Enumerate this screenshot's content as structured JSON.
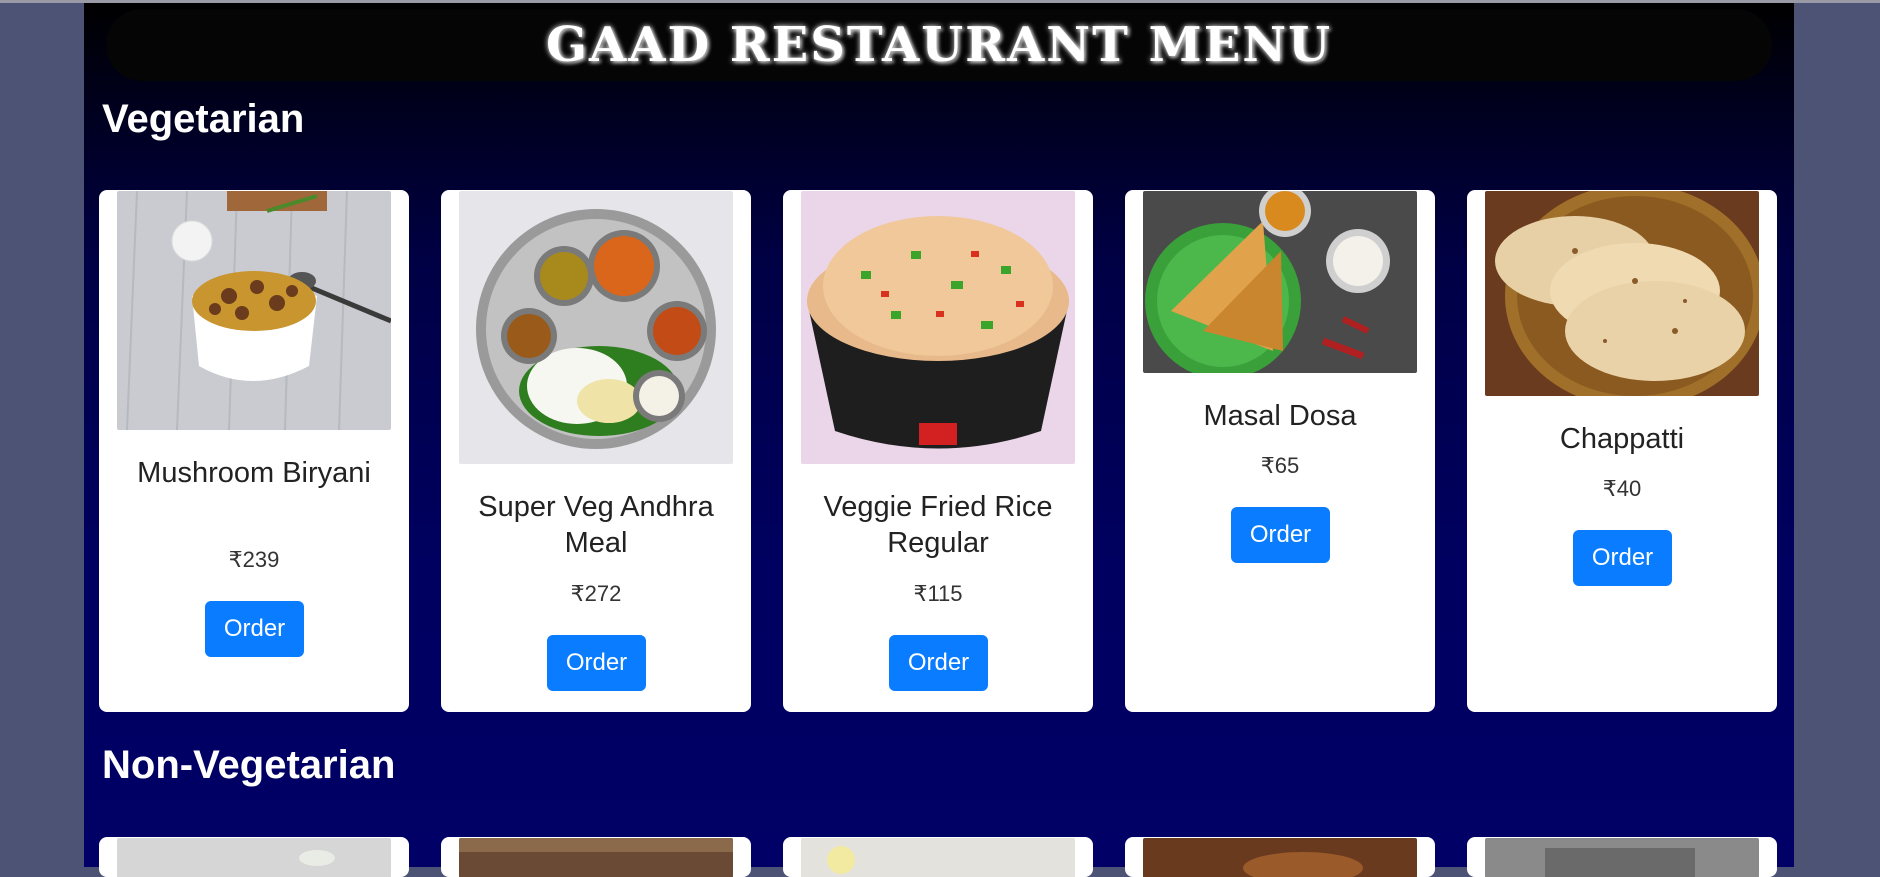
{
  "title": "GAAD RESTAURANT MENU",
  "sections": [
    {
      "title": "Vegetarian",
      "items": [
        {
          "name": "Mushroom Biryani",
          "price": "₹239",
          "order_label": "Order",
          "image": "mushroom-biryani-photo"
        },
        {
          "name": "Super Veg Andhra Meal",
          "price": "₹272",
          "order_label": "Order",
          "image": "andhra-meal-thali-photo"
        },
        {
          "name": "Veggie Fried Rice Regular",
          "price": "₹115",
          "order_label": "Order",
          "image": "fried-rice-bowl-photo"
        },
        {
          "name": "Masal Dosa",
          "price": "₹65",
          "order_label": "Order",
          "image": "masala-dosa-plate-photo"
        },
        {
          "name": "Chappatti",
          "price": "₹40",
          "order_label": "Order",
          "image": "chapati-basket-photo"
        }
      ]
    },
    {
      "title": "Non-Vegetarian",
      "items": []
    }
  ],
  "colors": {
    "accent": "#0a7cff",
    "page_bg": "#4c5374",
    "panel_top": "#000000",
    "panel_bottom": "#000066"
  }
}
